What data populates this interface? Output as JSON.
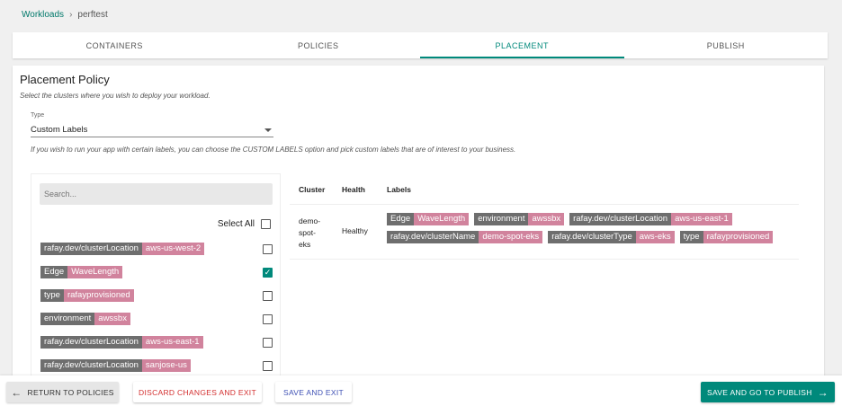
{
  "breadcrumb": {
    "root": "Workloads",
    "separator": "›",
    "current": "perftest"
  },
  "tabs": [
    {
      "label": "CONTAINERS",
      "active": false
    },
    {
      "label": "POLICIES",
      "active": false
    },
    {
      "label": "PLACEMENT",
      "active": true
    },
    {
      "label": "PUBLISH",
      "active": false
    }
  ],
  "placement": {
    "title": "Placement Policy",
    "subtitle": "Select the clusters where you wish to deploy your workload.",
    "type_label": "Type",
    "type_value": "Custom Labels",
    "type_hint": "If you wish to run your app with certain labels, you can choose the CUSTOM LABELS option and pick custom labels that are of interest to your business."
  },
  "label_picker": {
    "search_placeholder": "Search...",
    "select_all": "Select All",
    "labels": [
      {
        "key": "rafay.dev/clusterLocation",
        "value": "aws-us-west-2",
        "checked": false
      },
      {
        "key": "Edge",
        "value": "WaveLength",
        "checked": true
      },
      {
        "key": "type",
        "value": "rafayprovisioned",
        "checked": false
      },
      {
        "key": "environment",
        "value": "awssbx",
        "checked": false
      },
      {
        "key": "rafay.dev/clusterLocation",
        "value": "aws-us-east-1",
        "checked": false
      },
      {
        "key": "rafay.dev/clusterLocation",
        "value": "sanjose-us",
        "checked": false
      }
    ]
  },
  "clusters_table": {
    "headers": {
      "cluster": "Cluster",
      "health": "Health",
      "labels": "Labels"
    },
    "rows": [
      {
        "cluster_lines": [
          "demo-",
          "spot-",
          "eks"
        ],
        "health": "Healthy",
        "labels": [
          {
            "key": "Edge",
            "value": "WaveLength"
          },
          {
            "key": "environment",
            "value": "awssbx"
          },
          {
            "key": "rafay.dev/clusterLocation",
            "value": "aws-us-east-1"
          },
          {
            "key": "rafay.dev/clusterName",
            "value": "demo-spot-eks"
          },
          {
            "key": "rafay.dev/clusterType",
            "value": "aws-eks"
          },
          {
            "key": "type",
            "value": "rafayprovisioned"
          }
        ]
      }
    ]
  },
  "footer": {
    "back": "RETURN TO POLICIES",
    "discard": "DISCARD CHANGES AND EXIT",
    "save": "SAVE AND EXIT",
    "publish": "SAVE AND GO TO PUBLISH"
  },
  "icons": {
    "back": "arrow-left-icon",
    "forward": "arrow-right-icon",
    "dropdown": "caret-down-icon",
    "check": "checkmark-icon"
  },
  "colors": {
    "accent": "#00897b",
    "chip_key": "#6e6e6e",
    "chip_value": "#d1839d",
    "danger": "#d32f2f",
    "primary": "#3f51b5"
  }
}
